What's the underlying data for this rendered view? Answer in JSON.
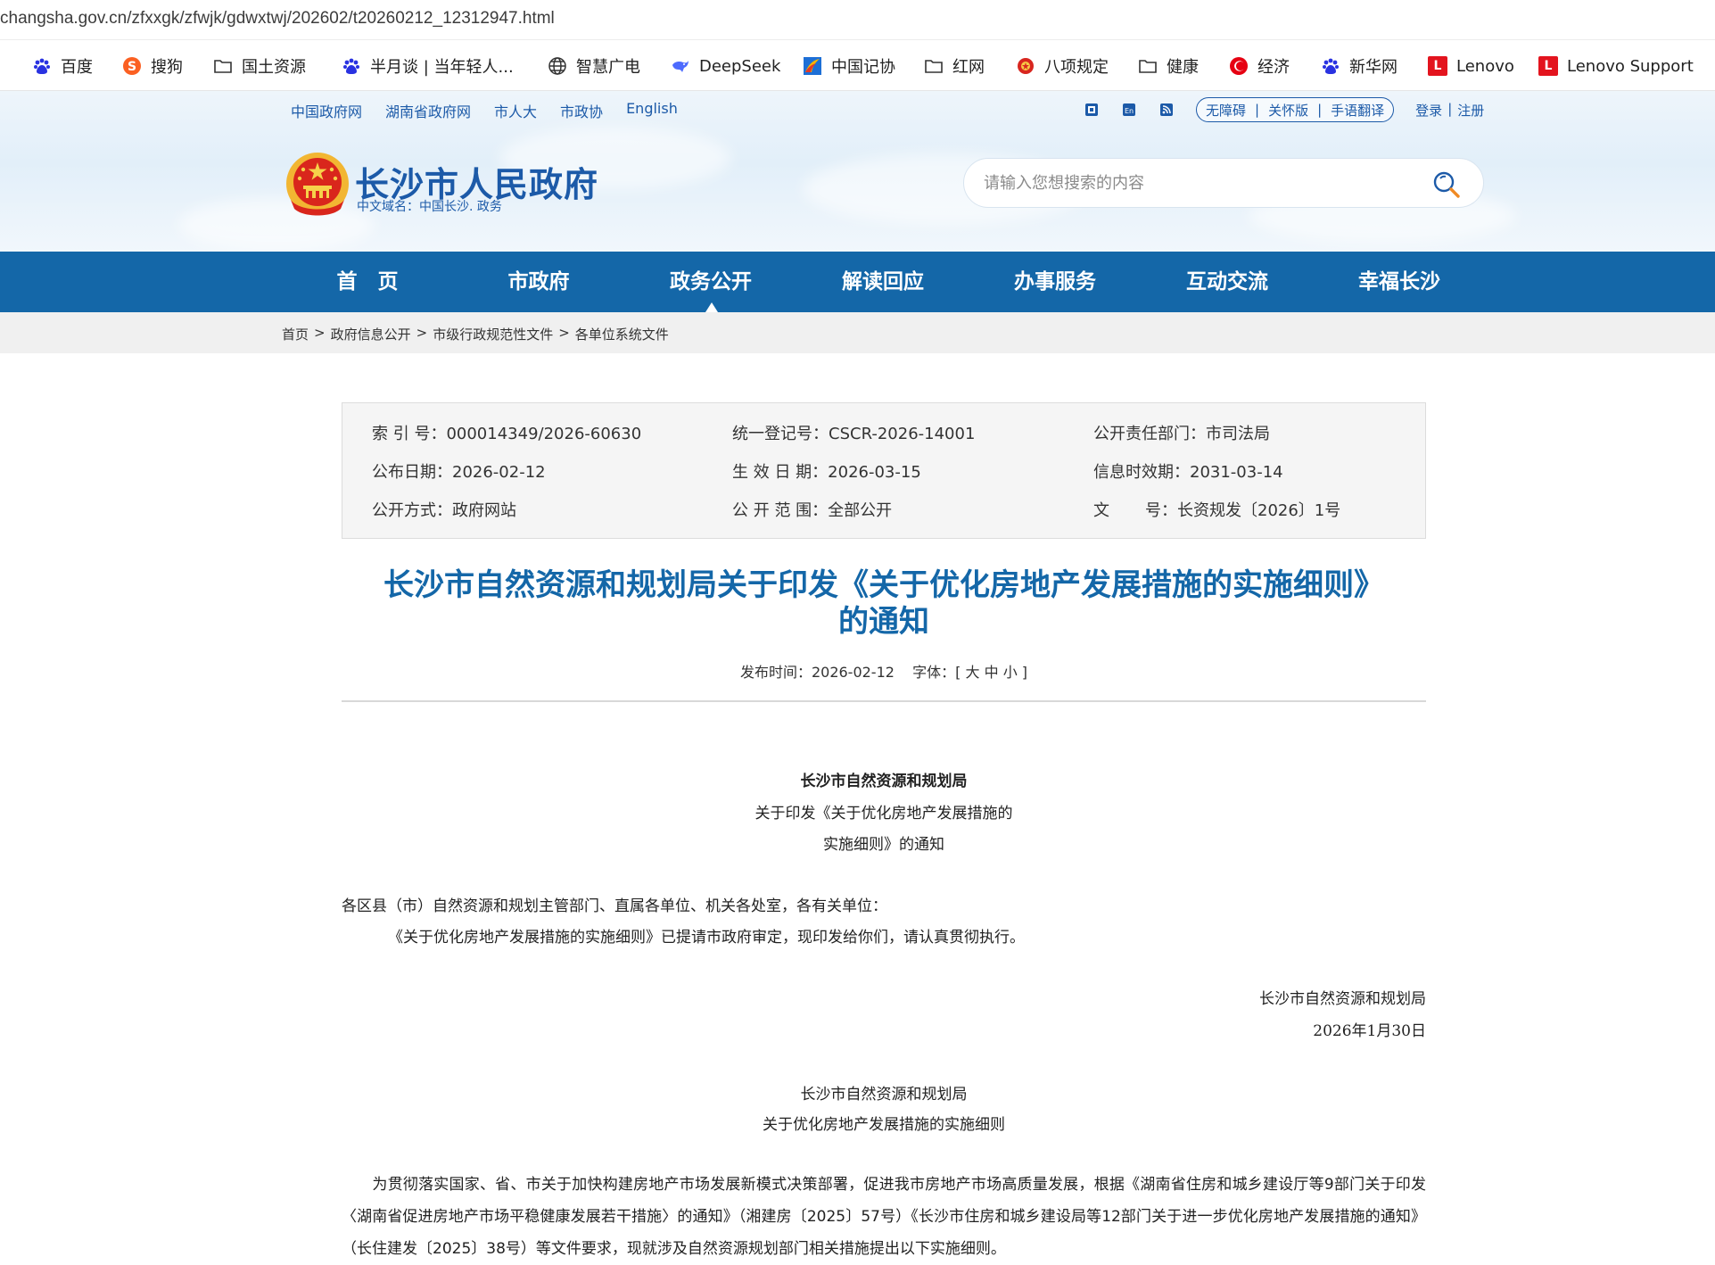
{
  "browser": {
    "url": "changsha.gov.cn/zfxxgk/zfwjk/gdwxtwj/202602/t20260212_12312947.html"
  },
  "bookmarks": [
    {
      "label": "百度",
      "icon": "baidu-paw-icon"
    },
    {
      "label": "搜狗",
      "icon": "sogou-icon"
    },
    {
      "label": "国土资源",
      "icon": "folder-icon"
    },
    {
      "label": "半月谈 | 当年轻人...",
      "icon": "baidu-paw-icon"
    },
    {
      "label": "智慧广电",
      "icon": "globe-icon"
    },
    {
      "label": "DeepSeek",
      "icon": "deepseek-whale-icon"
    },
    {
      "label": "中国记协",
      "icon": "zgjx-icon"
    },
    {
      "label": "红网",
      "icon": "folder-icon"
    },
    {
      "label": "八项规定",
      "icon": "emblem-icon"
    },
    {
      "label": "健康",
      "icon": "folder-icon"
    },
    {
      "label": "经济",
      "icon": "economy-icon"
    },
    {
      "label": "新华网",
      "icon": "baidu-paw-icon"
    },
    {
      "label": "Lenovo",
      "icon": "lenovo-icon"
    },
    {
      "label": "Lenovo Support",
      "icon": "lenovo-icon"
    }
  ],
  "header": {
    "top_links": [
      "中国政府网",
      "湖南省政府网",
      "市人大",
      "市政协",
      "English"
    ],
    "access": {
      "barrier_free": "无障碍",
      "care_mode": "关怀版",
      "sign_language": "手语翻译",
      "sep": "|"
    },
    "login": "登录",
    "register": "注册",
    "login_sep": "|",
    "title": "长沙市人民政府",
    "subtitle": "中文域名：中国长沙. 政务",
    "search_placeholder": "请输入您想搜索的内容"
  },
  "nav": {
    "items": [
      "首　页",
      "市政府",
      "政务公开",
      "解读回应",
      "办事服务",
      "互动交流",
      "幸福长沙"
    ],
    "active_index": 2
  },
  "breadcrumb": [
    "首页",
    "政府信息公开",
    "市级行政规范性文件",
    "各单位系统文件"
  ],
  "breadcrumb_sep": ">",
  "info": {
    "index_label": "索 引 号：",
    "index_value": "000014349/2026-60630",
    "reg_label": "统一登记号：",
    "reg_value": "CSCR-2026-14001",
    "dept_label": "公开责任部门：",
    "dept_value": "市司法局",
    "pub_date_label": "公布日期：",
    "pub_date_value": "2026-02-12",
    "eff_date_label": "生 效 日 期：",
    "eff_date_value": "2026-03-15",
    "valid_label": "信息时效期：",
    "valid_value": "2031-03-14",
    "mode_label": "公开方式：",
    "mode_value": "政府网站",
    "scope_label": "公 开 范 围：",
    "scope_value": "全部公开",
    "doc_label_1": "文",
    "doc_label_2": "号：",
    "doc_value": "长资规发〔2026〕1号"
  },
  "article": {
    "title_line1": "长沙市自然资源和规划局关于印发《关于优化房地产发展措施的实施细则》",
    "title_line2": "的通知",
    "meta_pub_label": "发布时间：",
    "meta_pub_value": "2026-02-12",
    "meta_font_label": "字体：[",
    "font_large": "大",
    "font_medium": "中",
    "font_small": "小",
    "meta_font_end": "]",
    "heading1": "长沙市自然资源和规划局",
    "heading2": "关于印发《关于优化房地产发展措施的",
    "heading3": "实施细则》的通知",
    "salutation": "各区县（市）自然资源和规划主管部门、直属各单位、机关各处室，各有关单位：",
    "para1": "《关于优化房地产发展措施的实施细则》已提请市政府审定，现印发给你们，请认真贯彻执行。",
    "sign_org": "长沙市自然资源和规划局",
    "sign_date": "2026年1月30日",
    "sub_heading1": "长沙市自然资源和规划局",
    "sub_heading2": "关于优化房地产发展措施的实施细则",
    "body": "　　为贯彻落实国家、省、市关于加快构建房地产市场发展新模式决策部署，促进我市房地产市场高质量发展，根据《湖南省住房和城乡建设厅等9部门关于印发〈湖南省促进房地产市场平稳健康发展若干措施〉的通知》（湘建房〔2025〕57号）《长沙市住房和城乡建设局等12部门关于进一步优化房地产发展措施的通知》（长住建发〔2025〕38号）等文件要求，现就涉及自然资源规划部门相关措施提出以下实施细则。"
  },
  "colors": {
    "brand_blue": "#1467a8",
    "link_blue": "#1c5aa8",
    "crumb_bg": "#f0f0f0"
  }
}
